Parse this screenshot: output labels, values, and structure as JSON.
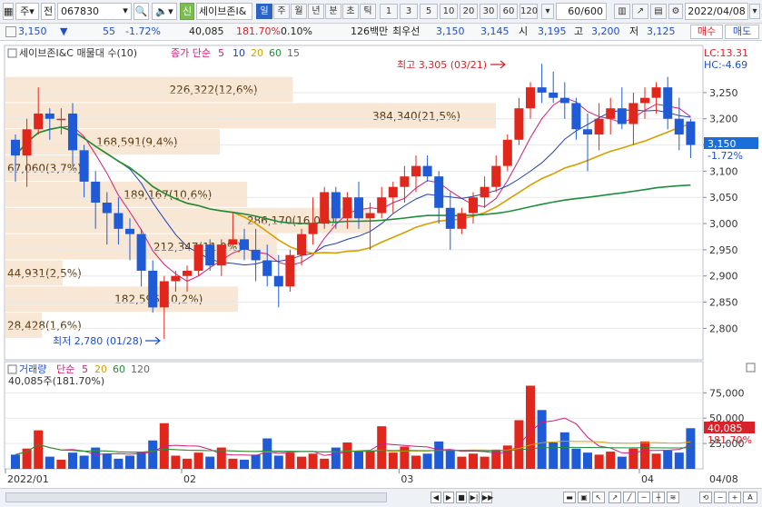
{
  "toolbar": {
    "type_select": "주",
    "prev_label": "전",
    "code": "067830",
    "badge": "신",
    "name": "세이브존I&",
    "periods": [
      "일",
      "주",
      "월",
      "년",
      "분",
      "초",
      "틱"
    ],
    "active_period": "일",
    "intervals": [
      "1",
      "3",
      "5",
      "10",
      "20",
      "30",
      "60",
      "120"
    ],
    "count": "60/600",
    "date": "2022/04/08"
  },
  "quote": {
    "price": "3,150",
    "change": "55",
    "rate": "-1.72%",
    "volume": "40,085",
    "vol_ratio": "181.70%",
    "turnover": "0.10%",
    "amount": "126백만",
    "best_ask_label": "최우선",
    "best_ask": "3,150",
    "best_bid": "3,145",
    "open_label": "시",
    "open": "3,195",
    "high_label": "고",
    "high": "3,200",
    "low_label": "저",
    "low": "3,125",
    "buy_label": "매수",
    "sell_label": "매도"
  },
  "price_panel": {
    "title": "세이브존I&C 매물대 수(10)",
    "ma_label": "종가 단순",
    "ma_periods": [
      "5",
      "10",
      "20",
      "60",
      "15"
    ],
    "lc": "LC:13.31",
    "hc": "HC:-4.69",
    "high_note": "최고 3,305 (03/21)",
    "low_note": "최저 2,780 (01/28)",
    "current_price": "3,150",
    "current_rate": "-1.72%"
  },
  "volume_panel": {
    "title": "거래량",
    "ma_label": "단순",
    "ma_periods": [
      "5",
      "20",
      "60",
      "120"
    ],
    "current_note": "40,085주(181.70%)",
    "current_value": "40,085",
    "current_rate": "181.70%"
  },
  "axis": {
    "price_ticks": [
      "3,250",
      "3,200",
      "3,150",
      "3,100",
      "3,050",
      "3,000",
      "2,950",
      "2,900",
      "2,850",
      "2,800"
    ],
    "volume_ticks": [
      "75,000",
      "50,000",
      "25,000"
    ],
    "date_labels": [
      "2022/01",
      "02",
      "03",
      "04"
    ],
    "end_date": "04/08"
  },
  "chart_data": {
    "type": "candlestick",
    "volume_profile": [
      {
        "label": "226,322(12,6%)",
        "price_from": 3230,
        "price_to": 3280
      },
      {
        "label": "384,340(21,5%)",
        "price_from": 3180,
        "price_to": 3230
      },
      {
        "label": "168,591(9,4%)",
        "price_from": 3130,
        "price_to": 3180
      },
      {
        "label": "67,060(3,7%)",
        "price_from": 3080,
        "price_to": 3130
      },
      {
        "label": "189,167(10,6%)",
        "price_from": 3030,
        "price_to": 3080
      },
      {
        "label": "286,170(16,0%)",
        "price_from": 2980,
        "price_to": 3030
      },
      {
        "label": "212,347(11,9%)",
        "price_from": 2930,
        "price_to": 2980
      },
      {
        "label": "44,931(2,5%)",
        "price_from": 2880,
        "price_to": 2930
      },
      {
        "label": "182,596(10,2%)",
        "price_from": 2830,
        "price_to": 2880
      },
      {
        "label": "28,428(1,6%)",
        "price_from": 2780,
        "price_to": 2830
      }
    ],
    "candles": [
      [
        3160,
        3170,
        3080,
        3130
      ],
      [
        3130,
        3200,
        3070,
        3180
      ],
      [
        3180,
        3260,
        3170,
        3210
      ],
      [
        3210,
        3220,
        3160,
        3200
      ],
      [
        3200,
        3220,
        3170,
        3200
      ],
      [
        3210,
        3230,
        3110,
        3140
      ],
      [
        3140,
        3150,
        3050,
        3080
      ],
      [
        3080,
        3100,
        2990,
        3040
      ],
      [
        3040,
        3060,
        2960,
        3020
      ],
      [
        3020,
        3050,
        2960,
        2990
      ],
      [
        2990,
        3010,
        2930,
        2980
      ],
      [
        2980,
        2990,
        2880,
        2910
      ],
      [
        2910,
        2930,
        2830,
        2840
      ],
      [
        2840,
        2900,
        2780,
        2890
      ],
      [
        2890,
        2910,
        2870,
        2900
      ],
      [
        2900,
        2920,
        2870,
        2910
      ],
      [
        2910,
        2960,
        2900,
        2960
      ],
      [
        2960,
        2970,
        2910,
        2920
      ],
      [
        2920,
        2970,
        2900,
        2960
      ],
      [
        2960,
        3020,
        2960,
        2970
      ],
      [
        2970,
        2990,
        2930,
        2950
      ],
      [
        2950,
        2990,
        2890,
        2930
      ],
      [
        2930,
        2960,
        2880,
        2900
      ],
      [
        2900,
        2940,
        2840,
        2880
      ],
      [
        2880,
        2950,
        2870,
        2940
      ],
      [
        2940,
        2990,
        2920,
        2980
      ],
      [
        2980,
        3050,
        2960,
        3000
      ],
      [
        3000,
        3070,
        2990,
        3060
      ],
      [
        3060,
        3070,
        2990,
        3010
      ],
      [
        3010,
        3060,
        2990,
        3050
      ],
      [
        3050,
        3080,
        2990,
        3010
      ],
      [
        3010,
        3040,
        2950,
        3020
      ],
      [
        3020,
        3070,
        3010,
        3050
      ],
      [
        3050,
        3080,
        3020,
        3070
      ],
      [
        3070,
        3110,
        3040,
        3090
      ],
      [
        3090,
        3130,
        3060,
        3110
      ],
      [
        3110,
        3130,
        3080,
        3090
      ],
      [
        3090,
        3100,
        3000,
        3030
      ],
      [
        3030,
        3060,
        2950,
        2990
      ],
      [
        2990,
        3030,
        2980,
        3020
      ],
      [
        3020,
        3060,
        3000,
        3050
      ],
      [
        3050,
        3090,
        3030,
        3070
      ],
      [
        3070,
        3130,
        3060,
        3110
      ],
      [
        3110,
        3170,
        3100,
        3160
      ],
      [
        3160,
        3240,
        3150,
        3220
      ],
      [
        3220,
        3270,
        3200,
        3260
      ],
      [
        3260,
        3305,
        3230,
        3250
      ],
      [
        3250,
        3290,
        3230,
        3240
      ],
      [
        3240,
        3270,
        3200,
        3230
      ],
      [
        3230,
        3240,
        3160,
        3180
      ],
      [
        3180,
        3210,
        3100,
        3170
      ],
      [
        3170,
        3230,
        3140,
        3200
      ],
      [
        3200,
        3240,
        3170,
        3220
      ],
      [
        3220,
        3260,
        3180,
        3190
      ],
      [
        3190,
        3250,
        3150,
        3230
      ],
      [
        3230,
        3260,
        3200,
        3240
      ],
      [
        3240,
        3270,
        3210,
        3260
      ],
      [
        3260,
        3280,
        3180,
        3200
      ],
      [
        3200,
        3240,
        3140,
        3170
      ],
      [
        3195,
        3200,
        3125,
        3150
      ]
    ],
    "volume": [
      14000,
      20000,
      38000,
      12000,
      9000,
      16000,
      13000,
      21000,
      15000,
      10000,
      13000,
      17000,
      28000,
      45000,
      13000,
      10000,
      16000,
      12000,
      21000,
      10000,
      9000,
      14000,
      30000,
      13000,
      16000,
      12000,
      15000,
      10000,
      21000,
      26000,
      17000,
      18000,
      42000,
      16000,
      22000,
      13000,
      15000,
      27000,
      19000,
      12000,
      15000,
      12000,
      19000,
      23000,
      48000,
      82000,
      58000,
      26000,
      36000,
      20000,
      16000,
      14000,
      17000,
      12000,
      20000,
      27000,
      15000,
      18000,
      16000,
      40085
    ],
    "ma_periods": [
      5,
      10,
      20,
      60
    ]
  }
}
